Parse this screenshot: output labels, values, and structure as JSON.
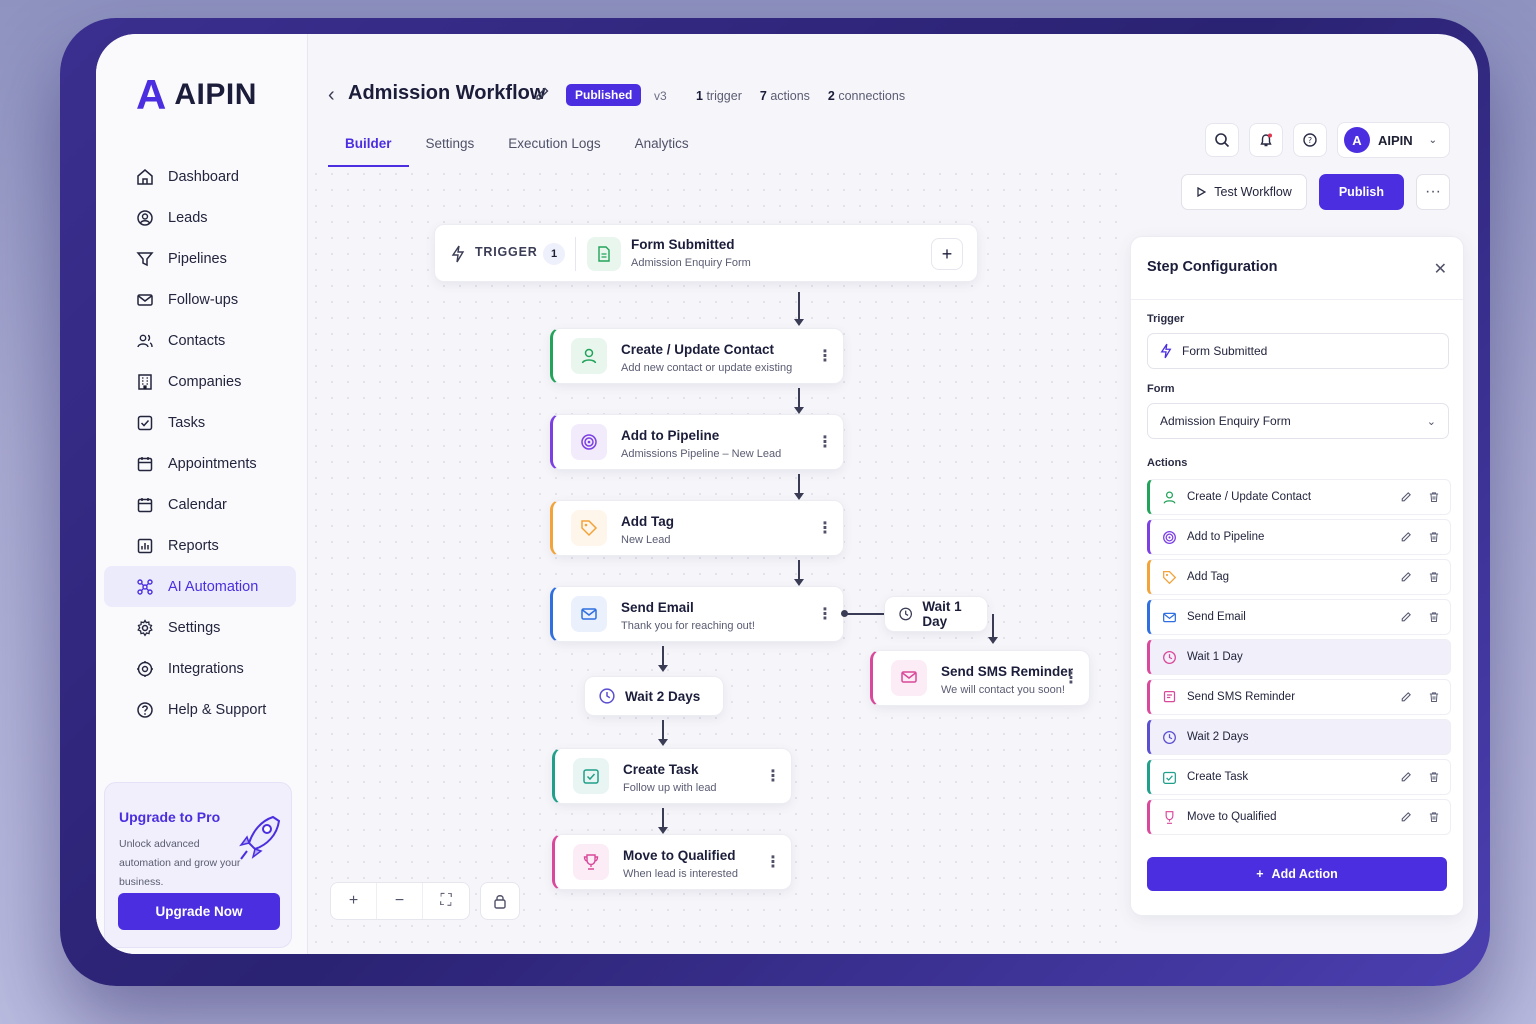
{
  "brand": {
    "mark": "A",
    "name": "AIPIN",
    "accent": "#4a2ee0"
  },
  "sidebar": {
    "items": [
      {
        "label": "Dashboard",
        "icon": "home-icon"
      },
      {
        "label": "Leads",
        "icon": "user-circle-icon"
      },
      {
        "label": "Pipelines",
        "icon": "funnel-icon"
      },
      {
        "label": "Follow-ups",
        "icon": "mail-icon"
      },
      {
        "label": "Contacts",
        "icon": "users-icon"
      },
      {
        "label": "Companies",
        "icon": "building-icon"
      },
      {
        "label": "Tasks",
        "icon": "checkbox-icon"
      },
      {
        "label": "Appointments",
        "icon": "calendar-icon"
      },
      {
        "label": "Calendar",
        "icon": "calendar-icon"
      },
      {
        "label": "Reports",
        "icon": "chart-icon"
      },
      {
        "label": "AI Automation",
        "icon": "nodes-icon",
        "active": true
      },
      {
        "label": "Settings",
        "icon": "gear-icon"
      },
      {
        "label": "Integrations",
        "icon": "plug-icon"
      },
      {
        "label": "Help & Support",
        "icon": "help-icon"
      }
    ],
    "upgrade": {
      "title": "Upgrade to Pro",
      "text": "Unlock advanced automation and grow your business.",
      "button": "Upgrade Now"
    }
  },
  "header": {
    "title": "Admission Workflow",
    "status": "Published",
    "version": "v3",
    "stats": [
      {
        "count": "1",
        "label": "trigger"
      },
      {
        "count": "7",
        "label": "actions"
      },
      {
        "count": "2",
        "label": "connections"
      }
    ],
    "tabs": [
      "Builder",
      "Settings",
      "Execution Logs",
      "Analytics"
    ],
    "active_tab": "Builder",
    "user": {
      "initial": "A",
      "name": "AIPIN"
    },
    "test_button": "Test Workflow",
    "publish_button": "Publish",
    "more_button": "···"
  },
  "canvas": {
    "trigger": {
      "label": "TRIGGER",
      "count": "1",
      "title": "Form Submitted",
      "subtitle": "Admission Enquiry Form"
    },
    "nodes": [
      {
        "title": "Create / Update Contact",
        "subtitle": "Add new contact or update existing",
        "color": "#22a35a"
      },
      {
        "title": "Add to Pipeline",
        "subtitle": "Admissions Pipeline – New Lead",
        "color": "#7b3fe4"
      },
      {
        "title": "Add Tag",
        "subtitle": "New Lead",
        "color": "#f2a33a"
      },
      {
        "title": "Send Email",
        "subtitle": "Thank you for reaching out!",
        "color": "#2f6fe0"
      },
      {
        "title": "Create Task",
        "subtitle": "Follow up with lead",
        "color": "#20a08a"
      },
      {
        "title": "Move to Qualified",
        "subtitle": "When lead is interested",
        "color": "#d9489a"
      }
    ],
    "wait_1": "Wait 2 Days",
    "wait_2": "Wait 1 Day",
    "sms": {
      "title": "Send SMS Reminder",
      "subtitle": "We will contact you soon!",
      "color": "#d9489a"
    },
    "zoom_controls": [
      "+",
      "−",
      "⛶"
    ]
  },
  "panel": {
    "title": "Step Configuration",
    "trigger_label": "Trigger",
    "trigger_value": "Form Submitted",
    "form_label": "Form",
    "form_value": "Admission Enquiry Form",
    "actions_label": "Actions",
    "actions": [
      {
        "label": "Create / Update Contact",
        "color": "#22a35a",
        "editable": true
      },
      {
        "label": "Add to Pipeline",
        "color": "#7b3fe4",
        "editable": true
      },
      {
        "label": "Add Tag",
        "color": "#f2a33a",
        "editable": true
      },
      {
        "label": "Send Email",
        "color": "#2f6fe0",
        "editable": true
      },
      {
        "label": "Wait 1 Day",
        "color": "#d9489a",
        "editable": false
      },
      {
        "label": "Send SMS Reminder",
        "color": "#d9489a",
        "editable": true
      },
      {
        "label": "Wait 2 Days",
        "color": "#5a4fd0",
        "editable": false
      },
      {
        "label": "Create Task",
        "color": "#20a08a",
        "editable": true
      },
      {
        "label": "Move to Qualified",
        "color": "#d9489a",
        "editable": true
      }
    ],
    "add_button": "Add Action"
  }
}
